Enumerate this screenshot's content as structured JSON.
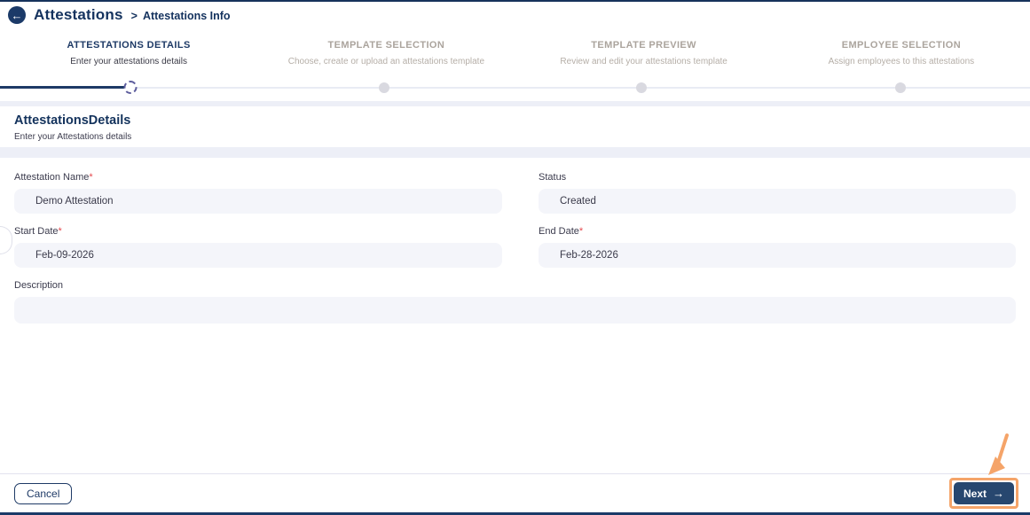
{
  "colors": {
    "navy": "#16325b",
    "button_navy": "#27476f",
    "muted_gray": "#aba49d",
    "input_bg": "#f4f5fa",
    "track": "#e9ebf4",
    "annotation_orange": "#f5a469",
    "required_red": "#e5484d"
  },
  "header": {
    "back_icon": "←",
    "title": "Attestations",
    "separator": ">",
    "subtitle": "Attestations Info"
  },
  "stepper": {
    "steps": [
      {
        "title": "ATTESTATIONS DETAILS",
        "subtitle": "Enter your attestations details",
        "state": "active"
      },
      {
        "title": "TEMPLATE SELECTION",
        "subtitle": "Choose, create or upload an attestations template",
        "state": "pending"
      },
      {
        "title": "TEMPLATE PREVIEW",
        "subtitle": "Review and edit your attestations template",
        "state": "pending"
      },
      {
        "title": "EMPLOYEE SELECTION",
        "subtitle": "Assign employees to this attestations",
        "state": "pending"
      }
    ]
  },
  "section": {
    "title": "AttestationsDetails",
    "subtitle": "Enter your Attestations details"
  },
  "form": {
    "attestation_name": {
      "label": "Attestation Name",
      "required": "*",
      "value": "Demo Attestation"
    },
    "status": {
      "label": "Status",
      "value": "Created"
    },
    "start_date": {
      "label": "Start Date",
      "required": "*",
      "value": "Feb-09-2026"
    },
    "end_date": {
      "label": "End Date",
      "required": "*",
      "value": "Feb-28-2026"
    },
    "description": {
      "label": "Description",
      "value": ""
    }
  },
  "footer": {
    "cancel_label": "Cancel",
    "next_label": "Next",
    "next_arrow": "→"
  }
}
